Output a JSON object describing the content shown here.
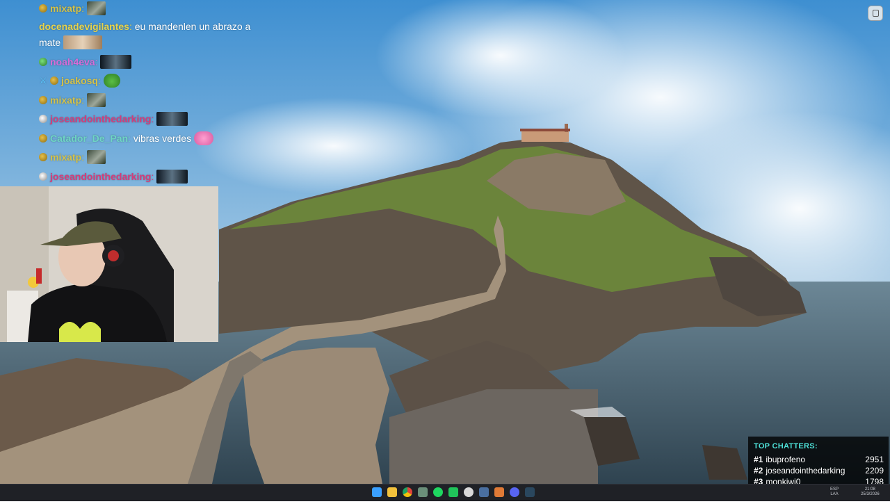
{
  "chat": {
    "messages": [
      {
        "badges": [
          "gold"
        ],
        "user": "mixatp",
        "color": "#d4c24a",
        "text": "",
        "emote": "img1"
      },
      {
        "badges": [],
        "user": "docenadevigilantes",
        "color": "#e8d34a",
        "text": "eu mandenlen un abrazo a",
        "emote": ""
      },
      {
        "badges": [],
        "user": "",
        "color": "#ffffff",
        "text": "mate",
        "emote": "cat"
      },
      {
        "badges": [
          "green"
        ],
        "user": "noah4eva",
        "color": "#d86bd8",
        "text": "",
        "emote": "img2"
      },
      {
        "badges": [
          "sword",
          "gold"
        ],
        "user": "joakosq",
        "color": "#d4c24a",
        "text": "",
        "emote": "pepe"
      },
      {
        "badges": [
          "gold"
        ],
        "user": "mixatp",
        "color": "#d4c24a",
        "text": "",
        "emote": "img1"
      },
      {
        "badges": [
          "gray"
        ],
        "user": "joseandointhedarking",
        "color": "#d63c7a",
        "text": "",
        "emote": "img2"
      },
      {
        "badges": [
          "gold"
        ],
        "user": "Catador_De_Pan",
        "color": "#6ed5c4",
        "text": "vibras verdes",
        "emote": "pink"
      },
      {
        "badges": [
          "gold"
        ],
        "user": "mixatp",
        "color": "#d4c24a",
        "text": "",
        "emote": "img1"
      },
      {
        "badges": [
          "gray"
        ],
        "user": "joseandointhedarking",
        "color": "#d63c7a",
        "text": "",
        "emote": "img2"
      }
    ]
  },
  "top_chatters": {
    "title": "TOP CHATTERS:",
    "rows": [
      {
        "rank": "#1",
        "name": "ibuprofeno",
        "count": "2951"
      },
      {
        "rank": "#2",
        "name": "joseandointhedarking",
        "count": "2209"
      },
      {
        "rank": "#3",
        "name": "monkiwi0",
        "count": "1798"
      }
    ]
  },
  "taskbar": {
    "icons": [
      "windows-start-icon",
      "file-explorer-icon",
      "chrome-icon",
      "app-icon",
      "spotify-icon",
      "green-app-icon",
      "app-icon-red",
      "steam-icon",
      "app-icon-2",
      "discord-icon",
      "steam-icon-2"
    ],
    "lang_top": "ESP",
    "lang_bottom": "LAA",
    "time": "21:08",
    "date": "25/3/2026"
  }
}
